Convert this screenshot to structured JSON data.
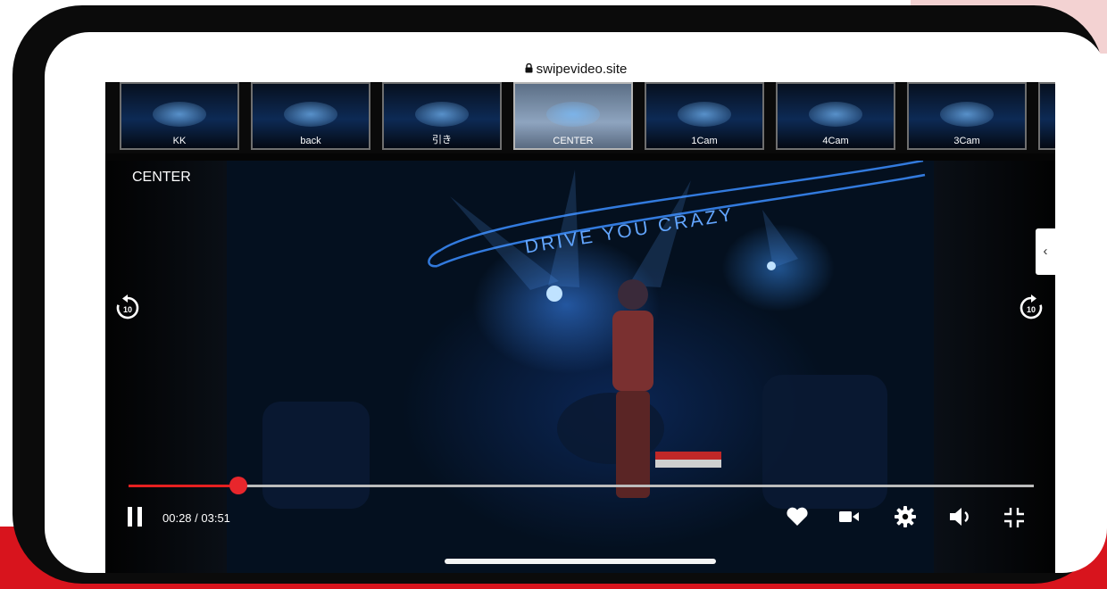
{
  "browser": {
    "url": "swipevideo.site"
  },
  "thumbnails": [
    {
      "label": "KK",
      "active": false
    },
    {
      "label": "back",
      "active": false
    },
    {
      "label": "引き",
      "active": false
    },
    {
      "label": "CENTER",
      "active": true
    },
    {
      "label": "1Cam",
      "active": false
    },
    {
      "label": "4Cam",
      "active": false
    },
    {
      "label": "3Cam",
      "active": false
    },
    {
      "label": "",
      "active": false
    }
  ],
  "player": {
    "current_camera": "CENTER",
    "stage_sign": "DRIVE YOU CRAZY",
    "rewind_icon": "replay-10-icon",
    "forward_icon": "forward-10-icon",
    "collapse_glyph": "‹",
    "time_display": "00:28 / 03:51",
    "progress_fraction": 0.1212,
    "accent_color": "#e62020"
  },
  "controls": {
    "play_state": "playing",
    "icons": [
      "pause-icon",
      "heart-icon",
      "video-camera-icon",
      "gear-icon",
      "volume-icon",
      "exit-fullscreen-icon"
    ]
  }
}
